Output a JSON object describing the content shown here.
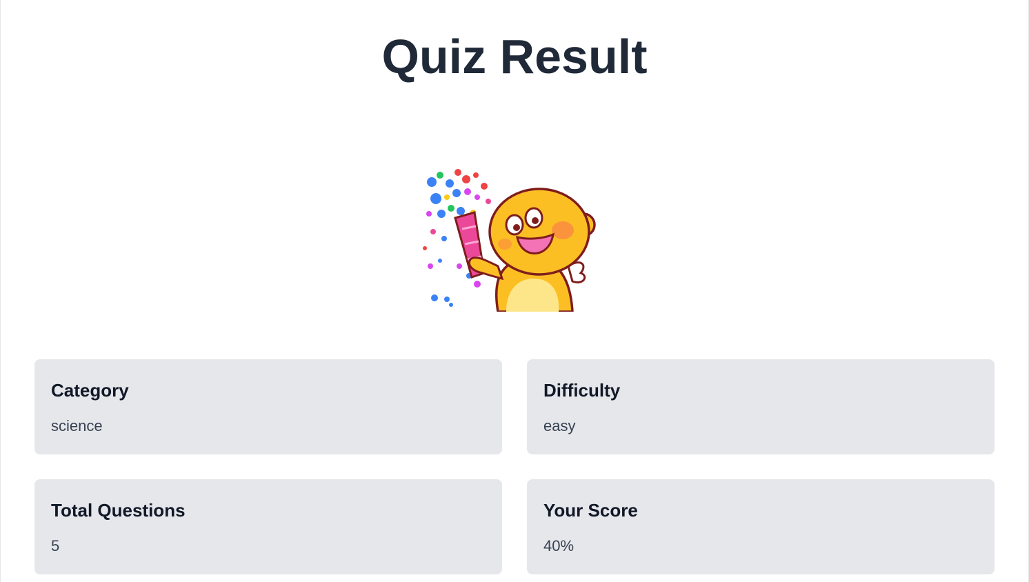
{
  "header": {
    "title": "Quiz Result"
  },
  "illustration": {
    "icon": "celebration-mascot-icon"
  },
  "results": [
    {
      "label": "Category",
      "value": "science"
    },
    {
      "label": "Difficulty",
      "value": "easy"
    },
    {
      "label": "Total Questions",
      "value": "5"
    },
    {
      "label": "Your Score",
      "value": "40%"
    }
  ],
  "colors": {
    "title": "#1f2937",
    "card_bg": "#e5e7eb",
    "mascot": "#fbbf24",
    "cheek": "#fb923c",
    "popper": "#ec4899"
  }
}
